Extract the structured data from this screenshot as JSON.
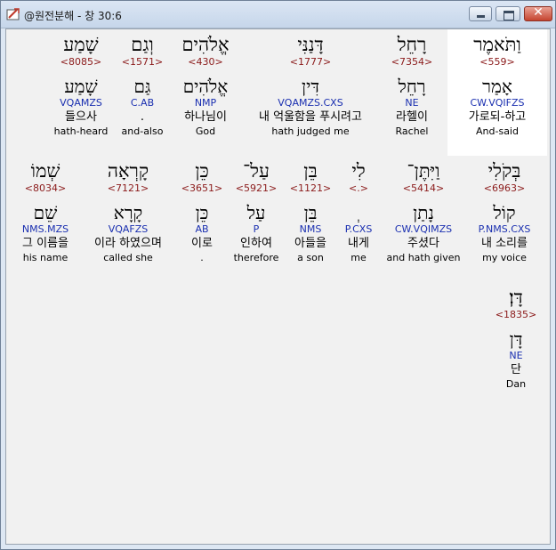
{
  "window": {
    "title": "@원전분해 - 창 30:6",
    "close_glyph": "✕"
  },
  "words": [
    {
      "heb": "וַתֹּאמֶר",
      "num": "<559>",
      "root": "אָמַר",
      "code": "CW.VQIFZS",
      "kor": "가로되-하고",
      "eng": "And-said",
      "selected": true
    },
    {
      "heb": "רָחֵל",
      "num": "<7354>",
      "root": "רָחֵל",
      "code": "NE",
      "kor": "라헬이",
      "eng": "Rachel"
    },
    {
      "heb": "דָּנַנִּי",
      "num": "<1777>",
      "root": "דִּין",
      "code": "VQAMZS.CXS",
      "kor": "내 억울함을 푸시려고",
      "eng": "hath judged me"
    },
    {
      "heb": "אֱלֹהִים",
      "num": "<430>",
      "root": "אֱלֹהִים",
      "code": "NMP",
      "kor": "하나님이",
      "eng": "God"
    },
    {
      "heb": "וְגַם",
      "num": "<1571>",
      "root": "גַּם",
      "code": "C.AB",
      "kor": ".",
      "eng": "and-also"
    },
    {
      "heb": "שָׁמַע",
      "num": "<8085>",
      "root": "שָׁמַע",
      "code": "VQAMZS",
      "kor": "들으사",
      "eng": "hath-heard"
    },
    {
      "heb": "בְּקֹלִי",
      "num": "<6963>",
      "root": "קוֹל",
      "code": "P.NMS.CXS",
      "kor": "내 소리를",
      "eng": "my voice"
    },
    {
      "heb": "וַיִּתֶּן־",
      "num": "<5414>",
      "root": "נָתַן",
      "code": "CW.VQIMZS",
      "kor": "주셨다",
      "eng": "and hath given"
    },
    {
      "heb": "לִי",
      "num": "<.>",
      "root": "ְ",
      "code": "P.CXS",
      "kor": "내게",
      "eng": "me"
    },
    {
      "heb": "בֵּן",
      "num": "<1121>",
      "root": "בֵּן",
      "code": "NMS",
      "kor": "아들을",
      "eng": "a son"
    },
    {
      "heb": "עַל־",
      "num": "<5921>",
      "root": "עַל",
      "code": "P",
      "kor": "인하여",
      "eng": "therefore"
    },
    {
      "heb": "כֵּן",
      "num": "<3651>",
      "root": "כֵּן",
      "code": "AB",
      "kor": "이로",
      "eng": "."
    },
    {
      "heb": "קָרְאָה",
      "num": "<7121>",
      "root": "קָרָא",
      "code": "VQAFZS",
      "kor": "이라 하였으며",
      "eng": "called she"
    },
    {
      "heb": "שְׁמוֹ",
      "num": "<8034>",
      "root": "שֵׁם",
      "code": "NMS.MZS",
      "kor": "그 이름을",
      "eng": "his name"
    },
    {
      "heb": "דָּן׃",
      "num": "<1835>",
      "root": "דָּן",
      "code": "NE",
      "kor": "단",
      "eng": "Dan"
    }
  ]
}
